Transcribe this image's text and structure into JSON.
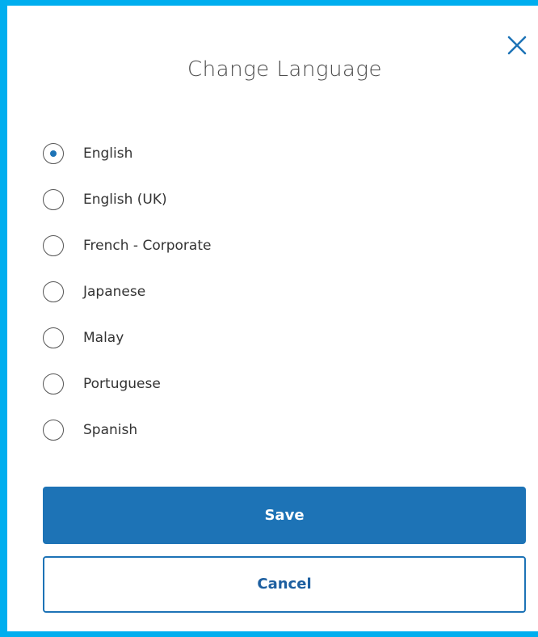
{
  "dialog": {
    "title": "Change Language",
    "close_icon": "close-icon",
    "selected_language": "English",
    "languages": [
      {
        "label": "English",
        "checked": true
      },
      {
        "label": "English (UK)",
        "checked": false
      },
      {
        "label": "French - Corporate",
        "checked": false
      },
      {
        "label": "Japanese",
        "checked": false
      },
      {
        "label": "Malay",
        "checked": false
      },
      {
        "label": "Portuguese",
        "checked": false
      },
      {
        "label": "Spanish",
        "checked": false
      }
    ],
    "save_label": "Save",
    "cancel_label": "Cancel"
  },
  "colors": {
    "accent": "#1d73b6",
    "frame_border": "#00aeef",
    "title_text": "#4a4a4a"
  }
}
